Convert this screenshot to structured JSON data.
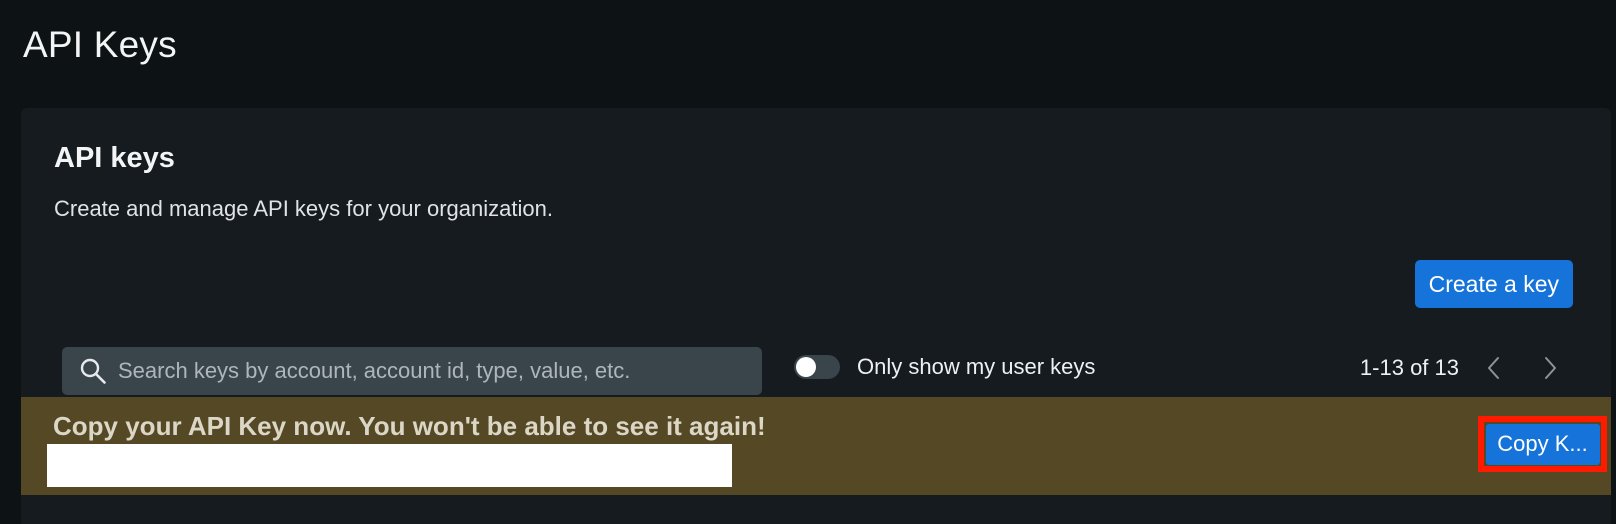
{
  "page": {
    "title": "API Keys"
  },
  "card": {
    "title": "API keys",
    "subtitle": "Create and manage API keys for your organization.",
    "create_button_label": "Create a key"
  },
  "search": {
    "placeholder": "Search keys by account, account id, type, value, etc.",
    "value": "",
    "icon": "search-icon"
  },
  "filter": {
    "toggle_label": "Only show my user keys",
    "toggle_on": false
  },
  "pagination": {
    "range_text": "1-13 of 13",
    "prev_icon": "chevron-left-icon",
    "next_icon": "chevron-right-icon"
  },
  "banner": {
    "message": "Copy your API Key now. You won't be able to see it again!",
    "copy_button_label": "Copy K..."
  },
  "colors": {
    "background": "#0d1214",
    "card": "#151b1e",
    "accent": "#1573d9",
    "banner": "#544825",
    "highlight": "#ff1a00"
  }
}
